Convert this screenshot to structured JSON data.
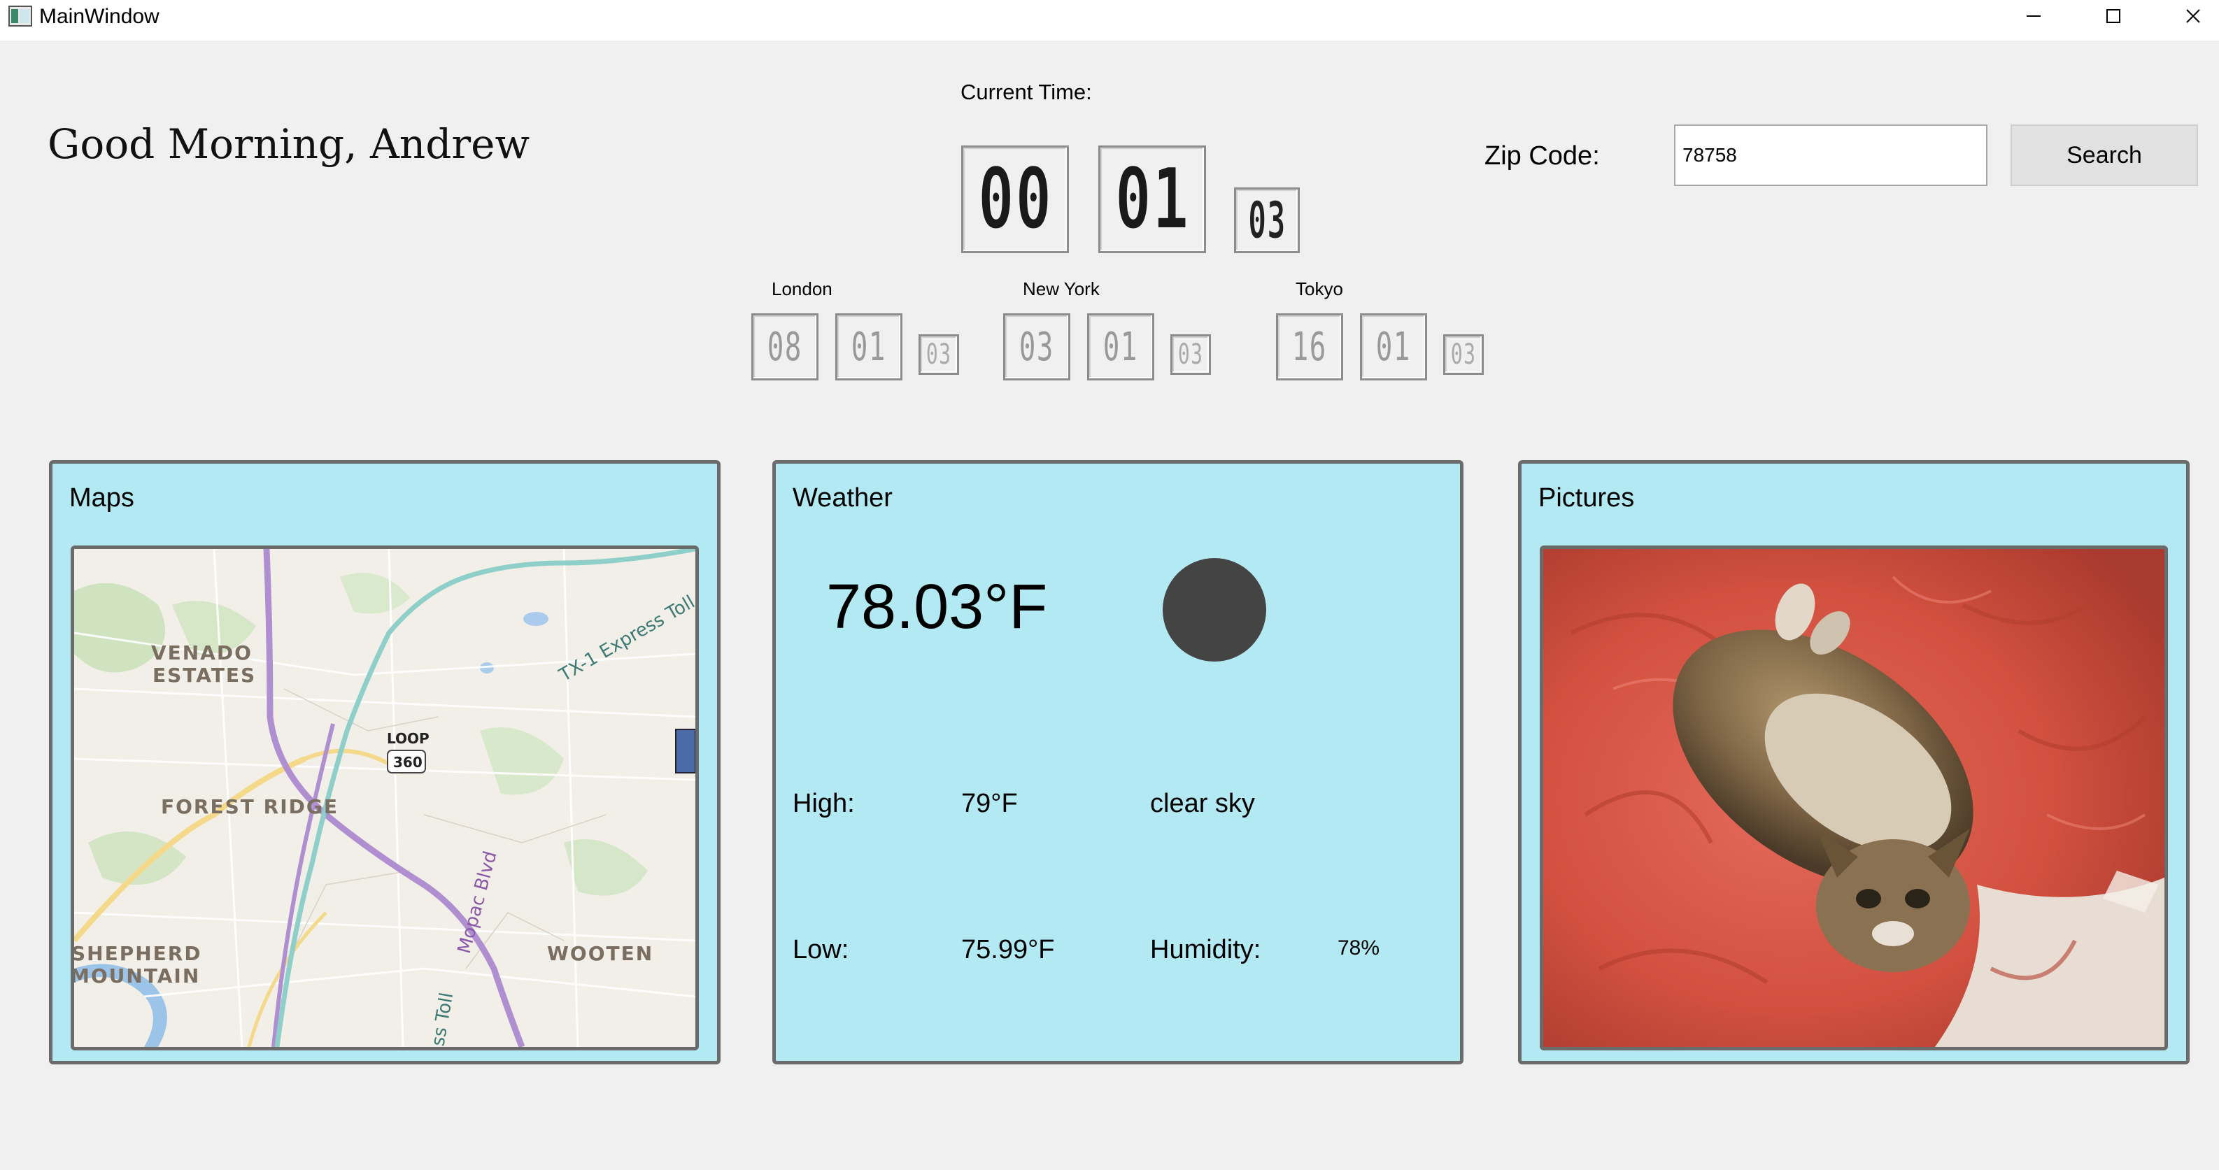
{
  "window": {
    "title": "MainWindow"
  },
  "greeting": "Good Morning, Andrew",
  "current_time": {
    "label": "Current Time:",
    "hours": "00",
    "minutes": "01",
    "seconds": "03"
  },
  "world_clocks": [
    {
      "city": "London",
      "hours": "08",
      "minutes": "01",
      "seconds": "03"
    },
    {
      "city": "New York",
      "hours": "03",
      "minutes": "01",
      "seconds": "03"
    },
    {
      "city": "Tokyo",
      "hours": "16",
      "minutes": "01",
      "seconds": "03"
    }
  ],
  "zip": {
    "label": "Zip Code:",
    "value": "78758",
    "search_label": "Search"
  },
  "maps": {
    "title": "Maps",
    "labels": {
      "venado_1": "VENADO",
      "venado_2": "ESTATES",
      "forest_ridge": "FOREST RIDGE",
      "shepherd_1": "SHEPHERD",
      "shepherd_2": "MOUNTAIN",
      "wooten": "WOOTEN",
      "loop": "LOOP",
      "loop_num": "360",
      "tx1": "TX-1 Express Toll",
      "mopac": "Mopac Blvd",
      "toll": "ss Toll"
    }
  },
  "weather": {
    "title": "Weather",
    "temperature": "78.03°F",
    "icon": "clear-night-icon",
    "high_label": "High:",
    "high": "79°F",
    "description": "clear sky",
    "low_label": "Low:",
    "low": "75.99°F",
    "humidity_label": "Humidity:",
    "humidity": "78%"
  },
  "pictures": {
    "title": "Pictures"
  },
  "colors": {
    "panel_bg": "#b3e9f2",
    "panel_border": "#6b6b6b",
    "window_bg": "#f0f0f0"
  }
}
